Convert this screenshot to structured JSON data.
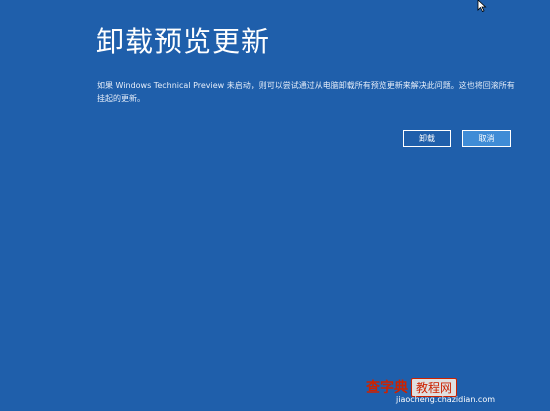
{
  "page": {
    "title": "卸载预览更新",
    "description": "如果 Windows Technical Preview 未启动，则可以尝试通过从电脑卸载所有预览更新来解决此问题。这也将回滚所有挂起的更新。"
  },
  "buttons": {
    "uninstall_label": "卸载",
    "cancel_label": "取消"
  },
  "watermark": {
    "brand": "查字典",
    "tag": "教程网",
    "url": "jiaocheng.chazidian.com"
  },
  "colors": {
    "background": "#1f5fab",
    "cancel_button": "#3f8cd6",
    "text": "#ffffff",
    "watermark_red": "#cc2200"
  },
  "icons": {
    "cursor": "mouse-pointer-icon"
  }
}
